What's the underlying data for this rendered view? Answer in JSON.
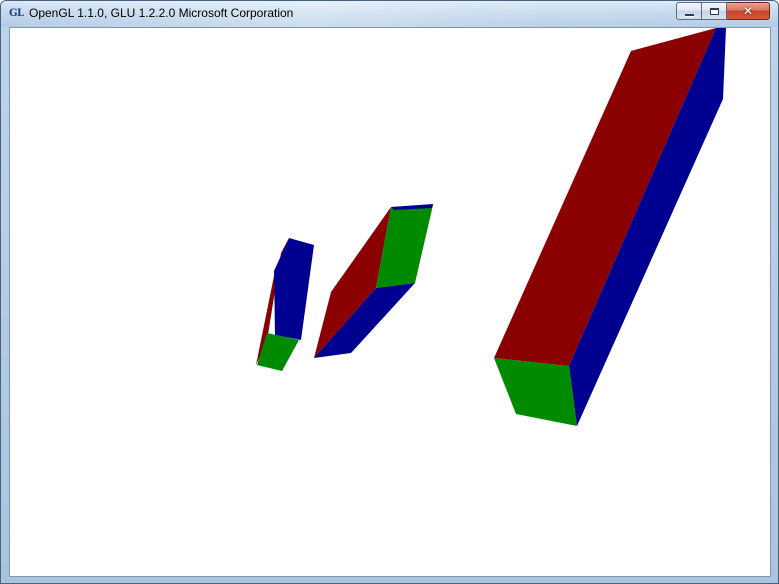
{
  "window": {
    "icon_text": "GL",
    "title": "OpenGL 1.1.0, GLU 1.2.2.0 Microsoft Corporation",
    "buttons": {
      "minimize_icon": "minimize-icon",
      "maximize_icon": "maximize-icon",
      "close_icon": "close-icon",
      "close_glyph": "✕"
    }
  },
  "scene": {
    "background": "#ffffff",
    "colors": {
      "red": "#8b0000",
      "blue": "#000090",
      "green": "#008a00"
    },
    "objects": [
      "small-box",
      "medium-box",
      "large-box"
    ]
  }
}
